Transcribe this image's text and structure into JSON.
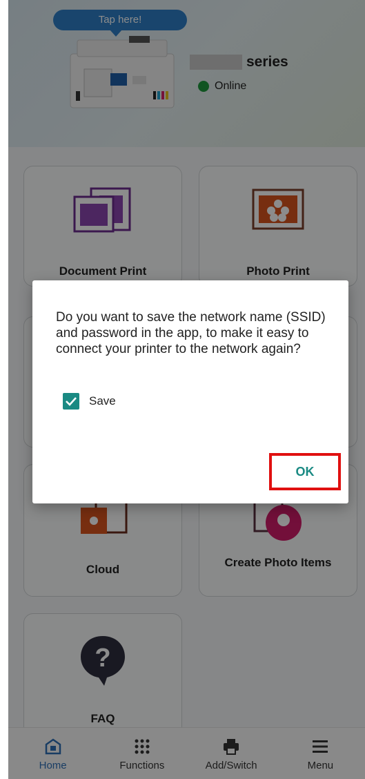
{
  "header": {
    "tap_label": "Tap here!",
    "series_label": "series",
    "status_text": "Online",
    "status_color": "#1e9a3d"
  },
  "cards": [
    {
      "label": "Document Print",
      "icon": "document-print-icon"
    },
    {
      "label": "Photo Print",
      "icon": "photo-print-icon"
    },
    {
      "label": "Cloud",
      "icon": "cloud-icon"
    },
    {
      "label": "Create Photo Items",
      "icon": "create-photo-items-icon"
    },
    {
      "label": "FAQ",
      "icon": "faq-icon"
    }
  ],
  "bottom_nav": [
    {
      "label": "Home",
      "icon": "home-icon",
      "active": true
    },
    {
      "label": "Functions",
      "icon": "functions-grid-icon",
      "active": false
    },
    {
      "label": "Add/Switch",
      "icon": "printer-icon",
      "active": false
    },
    {
      "label": "Menu",
      "icon": "hamburger-menu-icon",
      "active": false
    }
  ],
  "dialog": {
    "message": "Do you want to save the network name (SSID) and password in the app, to make it easy to connect your printer to the network again?",
    "checkbox_label": "Save",
    "checkbox_checked": true,
    "ok_label": "OK"
  },
  "colors": {
    "accent": "#1a8a83",
    "nav_active": "#2e6fb7",
    "highlight": "#e01010"
  }
}
